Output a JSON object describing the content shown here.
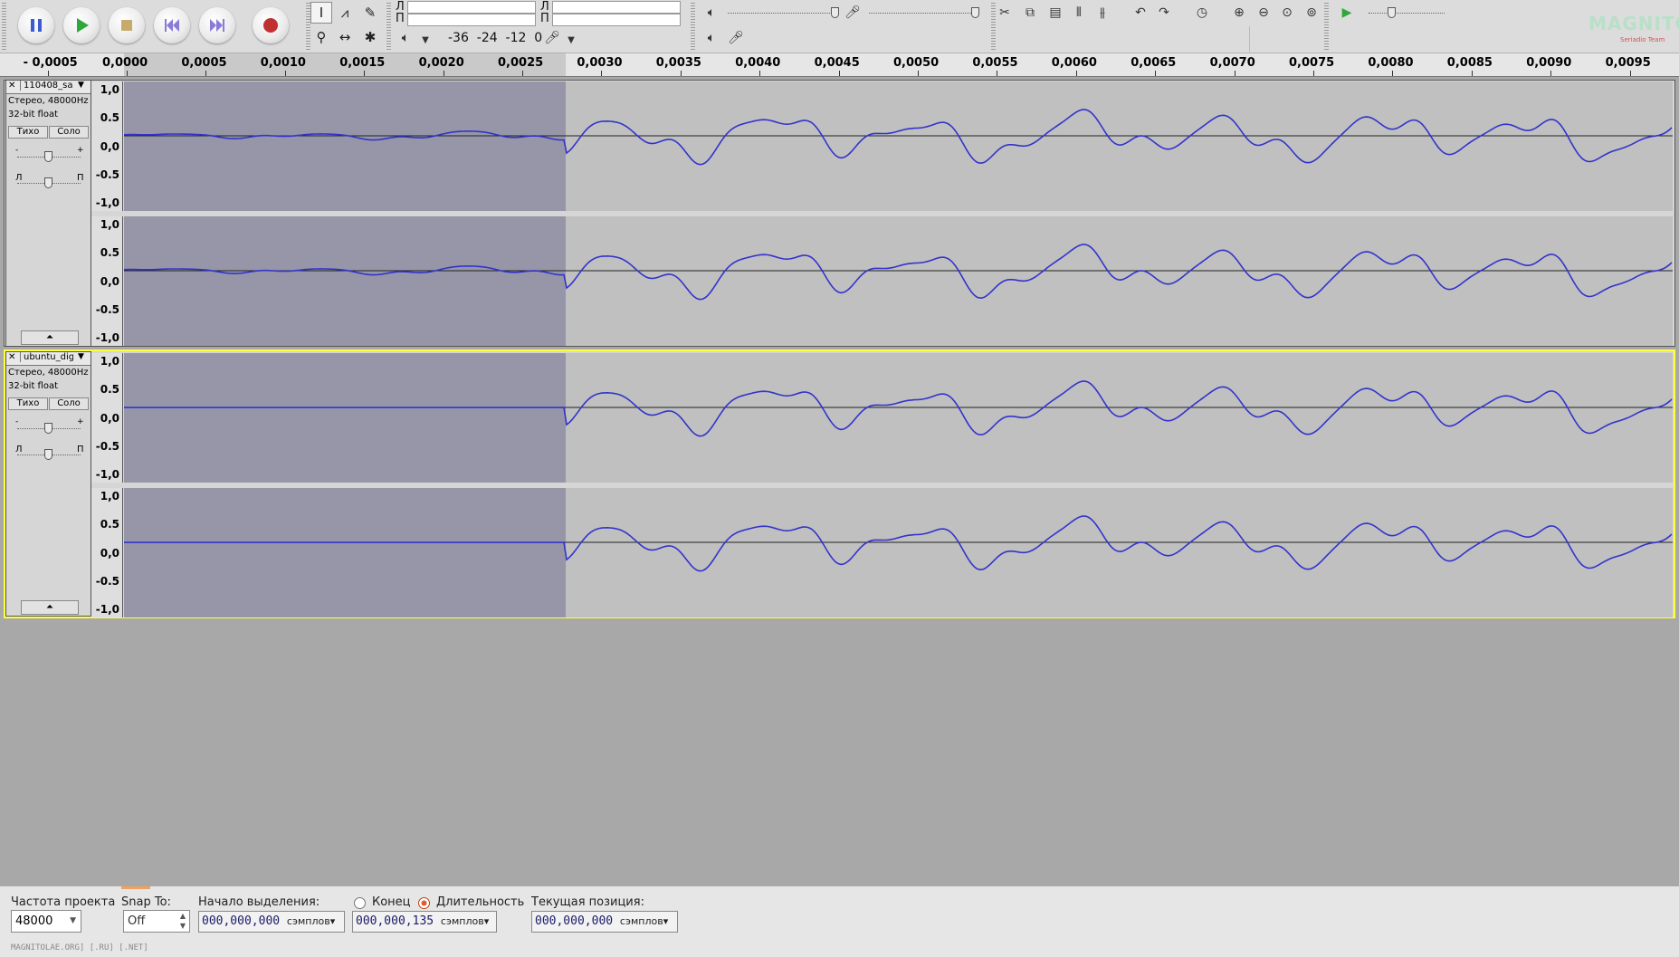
{
  "toolbar": {
    "buttons": [
      "pause",
      "play",
      "stop",
      "skip-start",
      "skip-end",
      "record"
    ],
    "meter_play_left": "Л",
    "meter_play_right": "П",
    "meter_rec_left": "Л",
    "meter_rec_right": "П",
    "meter_scale_play": "-36  -24  -12  0",
    "meter_scale_rec": "-36  -24  -12  0",
    "logo_text": "MAGNITOLA",
    "logo_sub": "Seriadio Team"
  },
  "ruler": {
    "ticks": [
      "- 0,0005",
      "0,0000",
      "0,0005",
      "0,0010",
      "0,0015",
      "0,0020",
      "0,0025",
      "0,0030",
      "0,0035",
      "0,0040",
      "0,0045",
      "0,0050",
      "0,0055",
      "0,0060",
      "0,0065",
      "0,0070",
      "0,0075",
      "0,0080",
      "0,0085",
      "0,0090",
      "0,0095"
    ]
  },
  "tracks": [
    {
      "name": "110408_sa",
      "format": "Стерео, 48000Hz",
      "bits": "32-bit float",
      "mute_label": "Тихо",
      "solo_label": "Соло",
      "gain_minus": "-",
      "gain_plus": "+",
      "pan_left": "Л",
      "pan_right": "П",
      "scale": [
        "1,0",
        "0.5",
        "0,0",
        "-0.5",
        "-1,0"
      ]
    },
    {
      "name": "ubuntu_digi",
      "format": "Стерео, 48000Hz",
      "bits": "32-bit float",
      "mute_label": "Тихо",
      "solo_label": "Соло",
      "gain_minus": "-",
      "gain_plus": "+",
      "pan_left": "Л",
      "pan_right": "П",
      "scale": [
        "1,0",
        "0.5",
        "0,0",
        "-0.5",
        "-1,0"
      ]
    }
  ],
  "bottom": {
    "project_rate_label": "Частота проекта",
    "project_rate_value": "48000",
    "snap_label": "Snap To:",
    "snap_value": "Off",
    "sel_start_label": "Начало выделения:",
    "end_label": "Конец",
    "length_label": "Длительность",
    "position_label": "Текущая позиция:",
    "sel_start_value": "000,000,000",
    "sel_len_value": "000,000,135",
    "position_value": "000,000,000",
    "unit": "сэмплов",
    "footer": "MAGNITOLAE.ORG] [.RU] [.NET]"
  },
  "colors": {
    "waveform": "#3333cc",
    "selection": "#9696a8",
    "track_bg": "#c0c0c0",
    "focus": "#ffff40"
  }
}
